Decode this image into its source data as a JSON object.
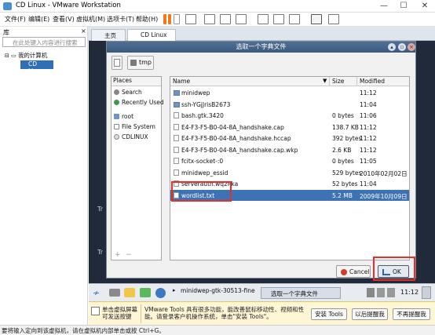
{
  "window": {
    "title": "CD Linux - VMware Workstation",
    "min": "—",
    "max": "☐",
    "close": "✕"
  },
  "menu": [
    "文件(F)",
    "编辑(E)",
    "查看(V)",
    "虚拟机(M)",
    "选项卡(T)",
    "帮助(H)"
  ],
  "library": {
    "header": "库",
    "close": "×",
    "search_placeholder": "在此处键入内容进行搜索",
    "tree_root": "我的计算机",
    "tree_child": "CD Linux"
  },
  "tabs": [
    {
      "label": "主页"
    },
    {
      "label": "CD Linux"
    }
  ],
  "guest_side_text": [
    "Tr",
    "Tr"
  ],
  "dialog": {
    "title": "选取一个字典文件",
    "path_button": "tmp",
    "places_header": "Places",
    "places": [
      {
        "label": "Search",
        "icon": "search-icon"
      },
      {
        "label": "Recently Used",
        "icon": "clock-icon"
      },
      {
        "label": "root",
        "icon": "folder-icon"
      },
      {
        "label": "File System",
        "icon": "drive-icon"
      },
      {
        "label": "CDLINUX",
        "icon": "cd-icon"
      }
    ],
    "add": "+",
    "remove": "−",
    "columns": {
      "name": "Name",
      "size": "Size",
      "modified": "Modified"
    },
    "files": [
      {
        "name": "minidwep",
        "size": "",
        "modified": "11:12",
        "folder": true
      },
      {
        "name": "ssh-YGjJrisB2673",
        "size": "",
        "modified": "11:04",
        "folder": true
      },
      {
        "name": "bash.gtk.3420",
        "size": "0 bytes",
        "modified": "11:06"
      },
      {
        "name": "E4-F3-F5-B0-04-8A_handshake.cap",
        "size": "138.7 KB",
        "modified": "11:12"
      },
      {
        "name": "E4-F3-F5-B0-04-8A_handshake.hccap",
        "size": "392 bytes",
        "modified": "11:12"
      },
      {
        "name": "E4-F3-F5-B0-04-8A_handshake.cap.wkp",
        "size": "2.6 KB",
        "modified": "11:12"
      },
      {
        "name": "fcitx-socket-:0",
        "size": "0 bytes",
        "modified": "11:05"
      },
      {
        "name": "minidwep_essid",
        "size": "529 bytes",
        "modified": "2010年02月02日"
      },
      {
        "name": "serverauth.wq2Pka",
        "size": "52 bytes",
        "modified": "11:04"
      },
      {
        "name": "wordlist.txt",
        "size": "5.2 MB",
        "modified": "2009年10月09日",
        "selected": true
      }
    ],
    "cancel": "Cancel",
    "ok": "OK"
  },
  "taskbar": {
    "task1": "minidwep-gtk-30513-fine",
    "task2": "选取一个字典文件",
    "clock": "11:12"
  },
  "hint": {
    "left": "单击虚拟屏幕\n可发送按键",
    "message": "VMware Tools 具有很多功能，能改善鼠标移动性、视频和性能。请登录客户机操作系统，单击\"安装 Tools\"。",
    "install": "安装 Tools",
    "remind": "以后提醒我",
    "never": "不再提醒我"
  },
  "status": "要将输入定向到该虚拟机，请在虚拟机内部单击或按 Ctrl+G。"
}
